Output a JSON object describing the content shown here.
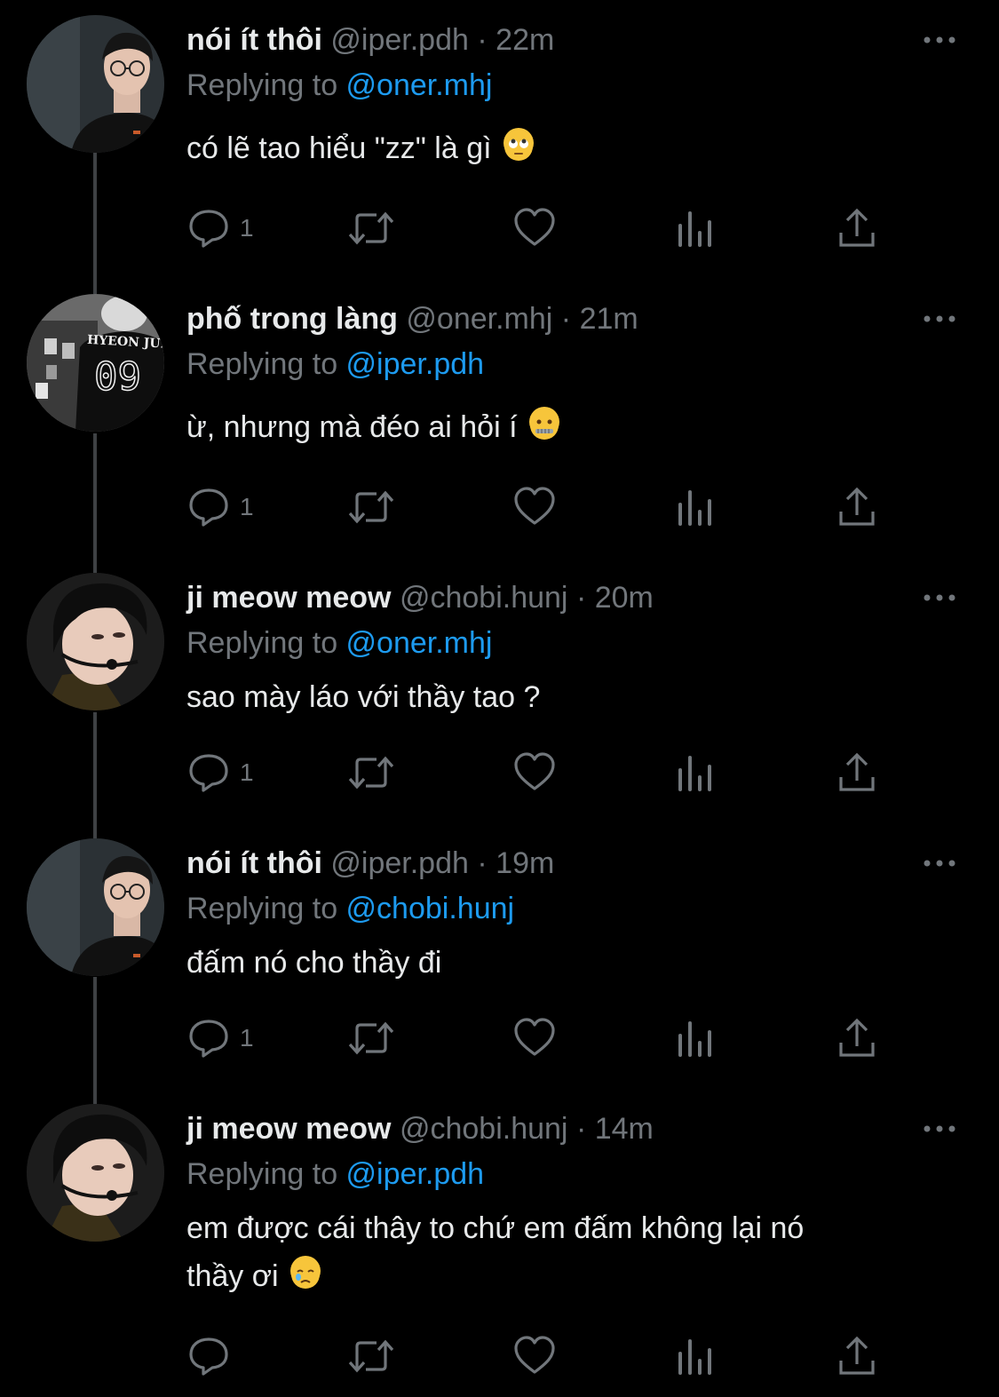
{
  "colors": {
    "background": "#000000",
    "primary_text": "#e7e9ea",
    "secondary_text": "#71767b",
    "link": "#1d9bf0",
    "thread_line": "#3e4144"
  },
  "tweets": [
    {
      "name": "nói ít thôi",
      "handle": "@iper.pdh",
      "dot": "·",
      "time": "22m",
      "replying_prefix": "Replying to ",
      "replying_to": "@oner.mhj",
      "text": "có lẽ tao hiểu \"zz\" là gì",
      "emoji": "face-with-rolling-eyes",
      "reply_count": "1",
      "avatar": "glasses-guy-avatar"
    },
    {
      "name": "phố trong làng",
      "handle": "@oner.mhj",
      "dot": "·",
      "time": "21m",
      "replying_prefix": "Replying to ",
      "replying_to": "@iper.pdh",
      "text": "ừ, nhưng mà đéo ai hỏi í",
      "emoji": "zipper-mouth-face",
      "reply_count": "1",
      "avatar": "jersey-avatar",
      "avatar_jersey_text": "HYEON JUN",
      "avatar_jersey_number": "09"
    },
    {
      "name": "ji meow meow",
      "handle": "@chobi.hunj",
      "dot": "·",
      "time": "20m",
      "replying_prefix": "Replying to ",
      "replying_to": "@oner.mhj",
      "text": "sao mày láo với thầy tao ?",
      "emoji": "",
      "reply_count": "1",
      "avatar": "headset-guy-avatar"
    },
    {
      "name": "nói ít thôi",
      "handle": "@iper.pdh",
      "dot": "·",
      "time": "19m",
      "replying_prefix": "Replying to ",
      "replying_to": "@chobi.hunj",
      "text": "đấm nó cho thầy đi",
      "emoji": "",
      "reply_count": "1",
      "avatar": "glasses-guy-avatar"
    },
    {
      "name": "ji meow meow",
      "handle": "@chobi.hunj",
      "dot": "·",
      "time": "14m",
      "replying_prefix": "Replying to ",
      "replying_to": "@iper.pdh",
      "text_line1": "em được cái thây to chứ em đấm không lại nó",
      "text_line2": "thầy ơi",
      "emoji": "face-holding-back-tears",
      "reply_count": "",
      "avatar": "headset-guy-avatar"
    }
  ]
}
